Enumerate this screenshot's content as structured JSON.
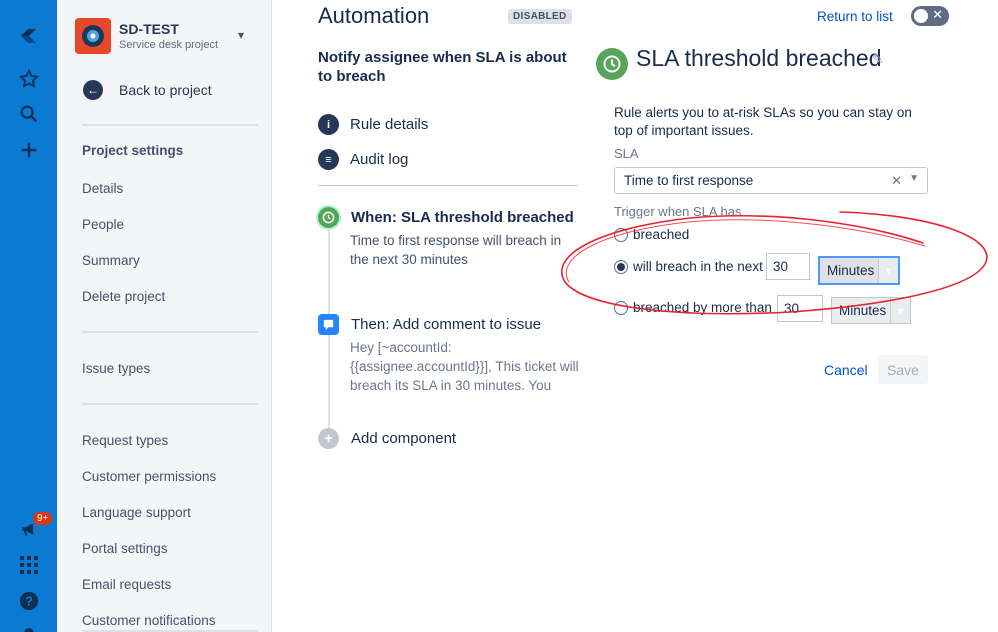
{
  "nav_rail": {
    "icons": [
      "jira-logo-icon",
      "star-icon",
      "search-icon",
      "plus-icon",
      "megaphone-icon",
      "apps-grid-icon",
      "help-icon",
      "settings-icon"
    ],
    "notification_badge": "9+",
    "bg_color": "#0A7AD3"
  },
  "sidebar": {
    "project_name": "SD-TEST",
    "project_type": "Service desk project",
    "back_label": "Back to project",
    "section_title": "Project settings",
    "items": [
      "Details",
      "People",
      "Summary",
      "Delete project"
    ],
    "issue_types": "Issue types",
    "items2": [
      "Request types",
      "Customer permissions",
      "Language support",
      "Portal settings",
      "Email requests",
      "Customer notifications"
    ]
  },
  "header": {
    "title": "Automation",
    "status": "DISABLED",
    "return_link": "Return to list"
  },
  "rule": {
    "name": "Notify assignee when SLA is about to breach",
    "rule_details": "Rule details",
    "audit_log": "Audit log",
    "when_title": "When: SLA threshold breached",
    "when_desc": "Time to first response will breach in the next 30 minutes",
    "then_title": "Then: Add comment to issue",
    "then_desc": "Hey [~accountId: {{assignee.accountId}}], This ticket will breach its SLA in 30 minutes. You",
    "add_component": "Add component"
  },
  "panel": {
    "title": "SLA threshold breached",
    "description": "Rule alerts you to at-risk SLAs so you can stay on top of important issues.",
    "sla_label": "SLA",
    "sla_value": "Time to first response",
    "trigger_label": "Trigger when SLA has",
    "options": {
      "breached": "breached",
      "will_breach": "will breach in the next",
      "breached_more": "breached by more than"
    },
    "will_breach_value": "30",
    "will_breach_unit": "Minutes",
    "breached_more_value": "30",
    "breached_more_unit": "Minutes",
    "selected_option": "will_breach",
    "cancel": "Cancel",
    "save": "Save"
  },
  "colors": {
    "accent": "#0052CC",
    "success": "#57A55A",
    "annotation": "#E8232F"
  }
}
